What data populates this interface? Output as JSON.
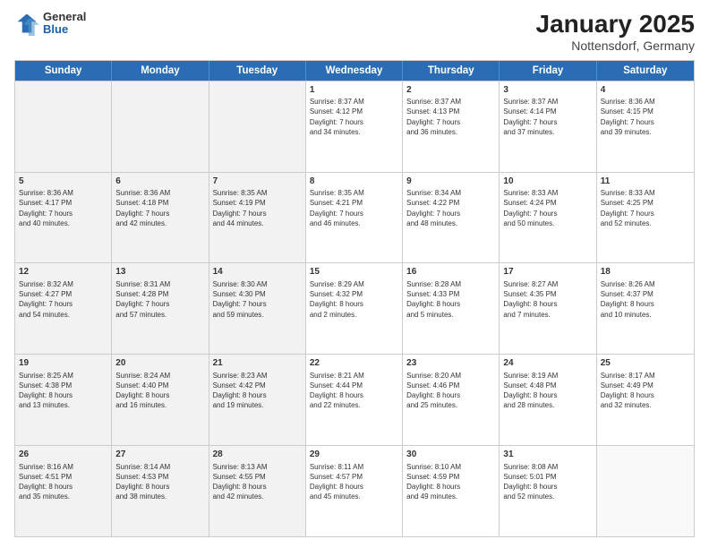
{
  "header": {
    "logo": {
      "general": "General",
      "blue": "Blue"
    },
    "title": "January 2025",
    "location": "Nottensdorf, Germany"
  },
  "calendar": {
    "weekdays": [
      "Sunday",
      "Monday",
      "Tuesday",
      "Wednesday",
      "Thursday",
      "Friday",
      "Saturday"
    ],
    "rows": [
      [
        {
          "day": "",
          "sunrise": "",
          "sunset": "",
          "daylight": "",
          "shaded": true
        },
        {
          "day": "",
          "sunrise": "",
          "sunset": "",
          "daylight": "",
          "shaded": true
        },
        {
          "day": "",
          "sunrise": "",
          "sunset": "",
          "daylight": "",
          "shaded": true
        },
        {
          "day": "1",
          "sunrise": "Sunrise: 8:37 AM",
          "sunset": "Sunset: 4:12 PM",
          "daylight": "Daylight: 7 hours and 34 minutes.",
          "shaded": false
        },
        {
          "day": "2",
          "sunrise": "Sunrise: 8:37 AM",
          "sunset": "Sunset: 4:13 PM",
          "daylight": "Daylight: 7 hours and 36 minutes.",
          "shaded": false
        },
        {
          "day": "3",
          "sunrise": "Sunrise: 8:37 AM",
          "sunset": "Sunset: 4:14 PM",
          "daylight": "Daylight: 7 hours and 37 minutes.",
          "shaded": false
        },
        {
          "day": "4",
          "sunrise": "Sunrise: 8:36 AM",
          "sunset": "Sunset: 4:15 PM",
          "daylight": "Daylight: 7 hours and 39 minutes.",
          "shaded": false
        }
      ],
      [
        {
          "day": "5",
          "sunrise": "Sunrise: 8:36 AM",
          "sunset": "Sunset: 4:17 PM",
          "daylight": "Daylight: 7 hours and 40 minutes.",
          "shaded": true
        },
        {
          "day": "6",
          "sunrise": "Sunrise: 8:36 AM",
          "sunset": "Sunset: 4:18 PM",
          "daylight": "Daylight: 7 hours and 42 minutes.",
          "shaded": true
        },
        {
          "day": "7",
          "sunrise": "Sunrise: 8:35 AM",
          "sunset": "Sunset: 4:19 PM",
          "daylight": "Daylight: 7 hours and 44 minutes.",
          "shaded": true
        },
        {
          "day": "8",
          "sunrise": "Sunrise: 8:35 AM",
          "sunset": "Sunset: 4:21 PM",
          "daylight": "Daylight: 7 hours and 46 minutes.",
          "shaded": false
        },
        {
          "day": "9",
          "sunrise": "Sunrise: 8:34 AM",
          "sunset": "Sunset: 4:22 PM",
          "daylight": "Daylight: 7 hours and 48 minutes.",
          "shaded": false
        },
        {
          "day": "10",
          "sunrise": "Sunrise: 8:33 AM",
          "sunset": "Sunset: 4:24 PM",
          "daylight": "Daylight: 7 hours and 50 minutes.",
          "shaded": false
        },
        {
          "day": "11",
          "sunrise": "Sunrise: 8:33 AM",
          "sunset": "Sunset: 4:25 PM",
          "daylight": "Daylight: 7 hours and 52 minutes.",
          "shaded": false
        }
      ],
      [
        {
          "day": "12",
          "sunrise": "Sunrise: 8:32 AM",
          "sunset": "Sunset: 4:27 PM",
          "daylight": "Daylight: 7 hours and 54 minutes.",
          "shaded": true
        },
        {
          "day": "13",
          "sunrise": "Sunrise: 8:31 AM",
          "sunset": "Sunset: 4:28 PM",
          "daylight": "Daylight: 7 hours and 57 minutes.",
          "shaded": true
        },
        {
          "day": "14",
          "sunrise": "Sunrise: 8:30 AM",
          "sunset": "Sunset: 4:30 PM",
          "daylight": "Daylight: 7 hours and 59 minutes.",
          "shaded": true
        },
        {
          "day": "15",
          "sunrise": "Sunrise: 8:29 AM",
          "sunset": "Sunset: 4:32 PM",
          "daylight": "Daylight: 8 hours and 2 minutes.",
          "shaded": false
        },
        {
          "day": "16",
          "sunrise": "Sunrise: 8:28 AM",
          "sunset": "Sunset: 4:33 PM",
          "daylight": "Daylight: 8 hours and 5 minutes.",
          "shaded": false
        },
        {
          "day": "17",
          "sunrise": "Sunrise: 8:27 AM",
          "sunset": "Sunset: 4:35 PM",
          "daylight": "Daylight: 8 hours and 7 minutes.",
          "shaded": false
        },
        {
          "day": "18",
          "sunrise": "Sunrise: 8:26 AM",
          "sunset": "Sunset: 4:37 PM",
          "daylight": "Daylight: 8 hours and 10 minutes.",
          "shaded": false
        }
      ],
      [
        {
          "day": "19",
          "sunrise": "Sunrise: 8:25 AM",
          "sunset": "Sunset: 4:38 PM",
          "daylight": "Daylight: 8 hours and 13 minutes.",
          "shaded": true
        },
        {
          "day": "20",
          "sunrise": "Sunrise: 8:24 AM",
          "sunset": "Sunset: 4:40 PM",
          "daylight": "Daylight: 8 hours and 16 minutes.",
          "shaded": true
        },
        {
          "day": "21",
          "sunrise": "Sunrise: 8:23 AM",
          "sunset": "Sunset: 4:42 PM",
          "daylight": "Daylight: 8 hours and 19 minutes.",
          "shaded": true
        },
        {
          "day": "22",
          "sunrise": "Sunrise: 8:21 AM",
          "sunset": "Sunset: 4:44 PM",
          "daylight": "Daylight: 8 hours and 22 minutes.",
          "shaded": false
        },
        {
          "day": "23",
          "sunrise": "Sunrise: 8:20 AM",
          "sunset": "Sunset: 4:46 PM",
          "daylight": "Daylight: 8 hours and 25 minutes.",
          "shaded": false
        },
        {
          "day": "24",
          "sunrise": "Sunrise: 8:19 AM",
          "sunset": "Sunset: 4:48 PM",
          "daylight": "Daylight: 8 hours and 28 minutes.",
          "shaded": false
        },
        {
          "day": "25",
          "sunrise": "Sunrise: 8:17 AM",
          "sunset": "Sunset: 4:49 PM",
          "daylight": "Daylight: 8 hours and 32 minutes.",
          "shaded": false
        }
      ],
      [
        {
          "day": "26",
          "sunrise": "Sunrise: 8:16 AM",
          "sunset": "Sunset: 4:51 PM",
          "daylight": "Daylight: 8 hours and 35 minutes.",
          "shaded": true
        },
        {
          "day": "27",
          "sunrise": "Sunrise: 8:14 AM",
          "sunset": "Sunset: 4:53 PM",
          "daylight": "Daylight: 8 hours and 38 minutes.",
          "shaded": true
        },
        {
          "day": "28",
          "sunrise": "Sunrise: 8:13 AM",
          "sunset": "Sunset: 4:55 PM",
          "daylight": "Daylight: 8 hours and 42 minutes.",
          "shaded": true
        },
        {
          "day": "29",
          "sunrise": "Sunrise: 8:11 AM",
          "sunset": "Sunset: 4:57 PM",
          "daylight": "Daylight: 8 hours and 45 minutes.",
          "shaded": false
        },
        {
          "day": "30",
          "sunrise": "Sunrise: 8:10 AM",
          "sunset": "Sunset: 4:59 PM",
          "daylight": "Daylight: 8 hours and 49 minutes.",
          "shaded": false
        },
        {
          "day": "31",
          "sunrise": "Sunrise: 8:08 AM",
          "sunset": "Sunset: 5:01 PM",
          "daylight": "Daylight: 8 hours and 52 minutes.",
          "shaded": false
        },
        {
          "day": "",
          "sunrise": "",
          "sunset": "",
          "daylight": "",
          "shaded": false
        }
      ]
    ]
  }
}
